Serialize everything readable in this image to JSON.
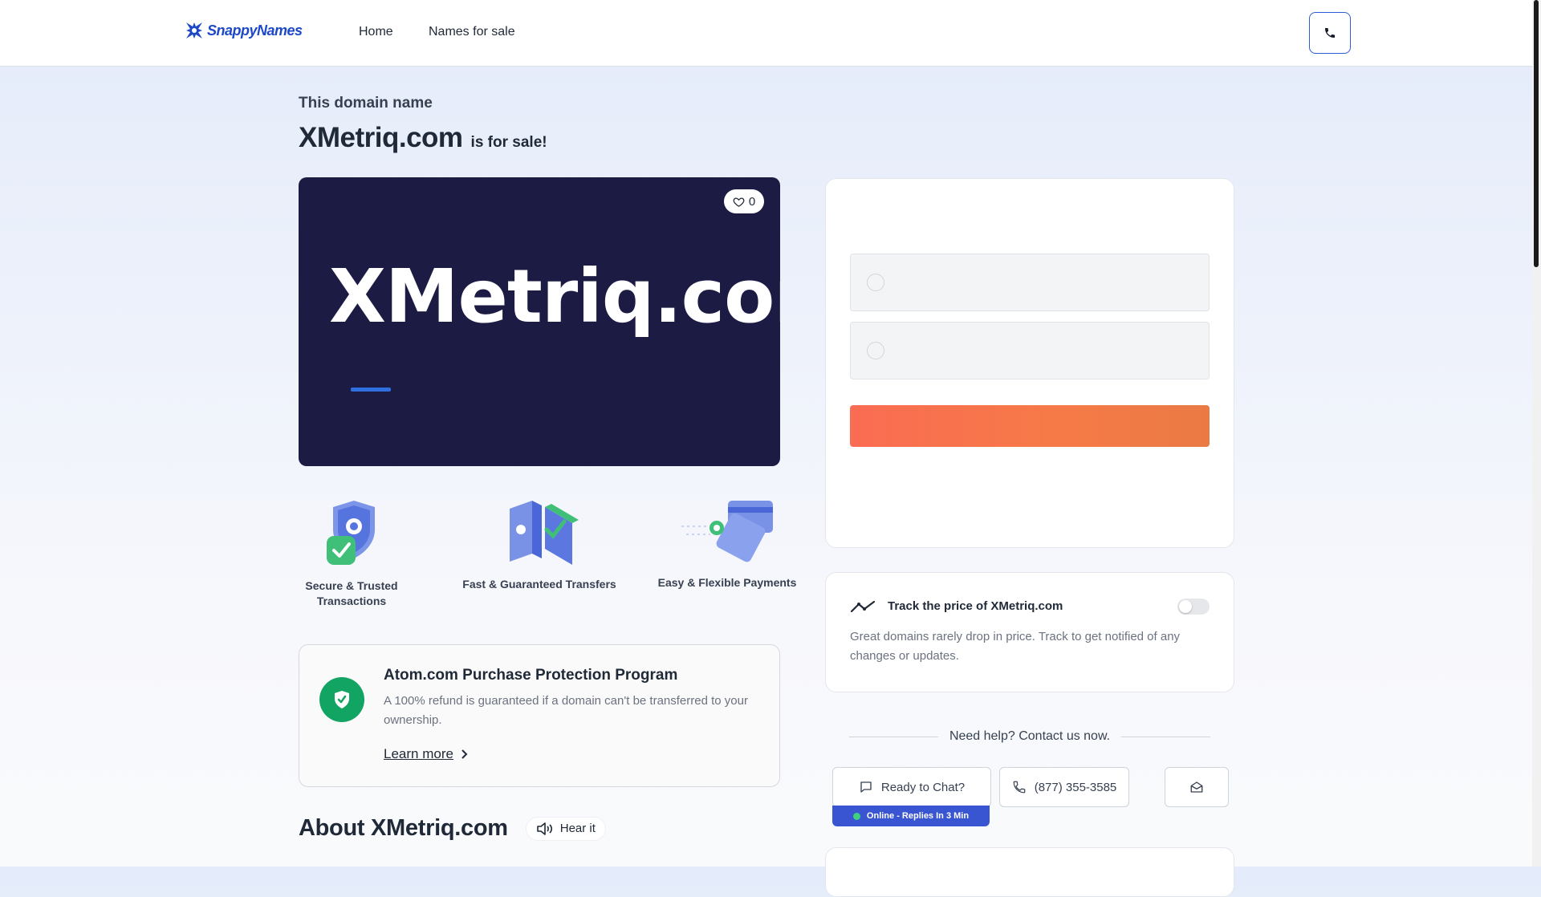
{
  "header": {
    "logo_text": "SnappyNames",
    "nav": [
      {
        "label": "Home"
      },
      {
        "label": "Names for sale"
      }
    ]
  },
  "hero": {
    "intro": "This domain name",
    "domain": "XMetriq.com",
    "suffix": "is for sale!",
    "image_text": "XMetriq.com",
    "likes": "0"
  },
  "features": [
    {
      "label": "Secure & Trusted Transactions",
      "icon": "shield-check-icon"
    },
    {
      "label": "Fast & Guaranteed Transfers",
      "icon": "transfer-icon"
    },
    {
      "label": "Easy & Flexible Payments",
      "icon": "payment-cards-icon"
    }
  ],
  "protection": {
    "title": "Atom.com Purchase Protection Program",
    "text": "A 100% refund is guaranteed if a domain can't be transferred to your ownership.",
    "link": "Learn more"
  },
  "about": {
    "title": "About XMetriq.com",
    "hear_label": "Hear it"
  },
  "track": {
    "title": "Track the price of XMetriq.com",
    "text": "Great domains rarely drop in price. Track to get notified of any changes or updates.",
    "enabled": false
  },
  "help": {
    "text": "Need help? Contact us now.",
    "chat_label": "Ready to Chat?",
    "phone_label": "(877) 355-3585",
    "online_status": "Online - Replies In 3 Min"
  },
  "colors": {
    "brand_blue": "#1d49c9",
    "hero_bg": "#1b1b44",
    "cta_orange": "#f76f4e",
    "success_green": "#12a463",
    "online_strip": "#3a55d2"
  }
}
